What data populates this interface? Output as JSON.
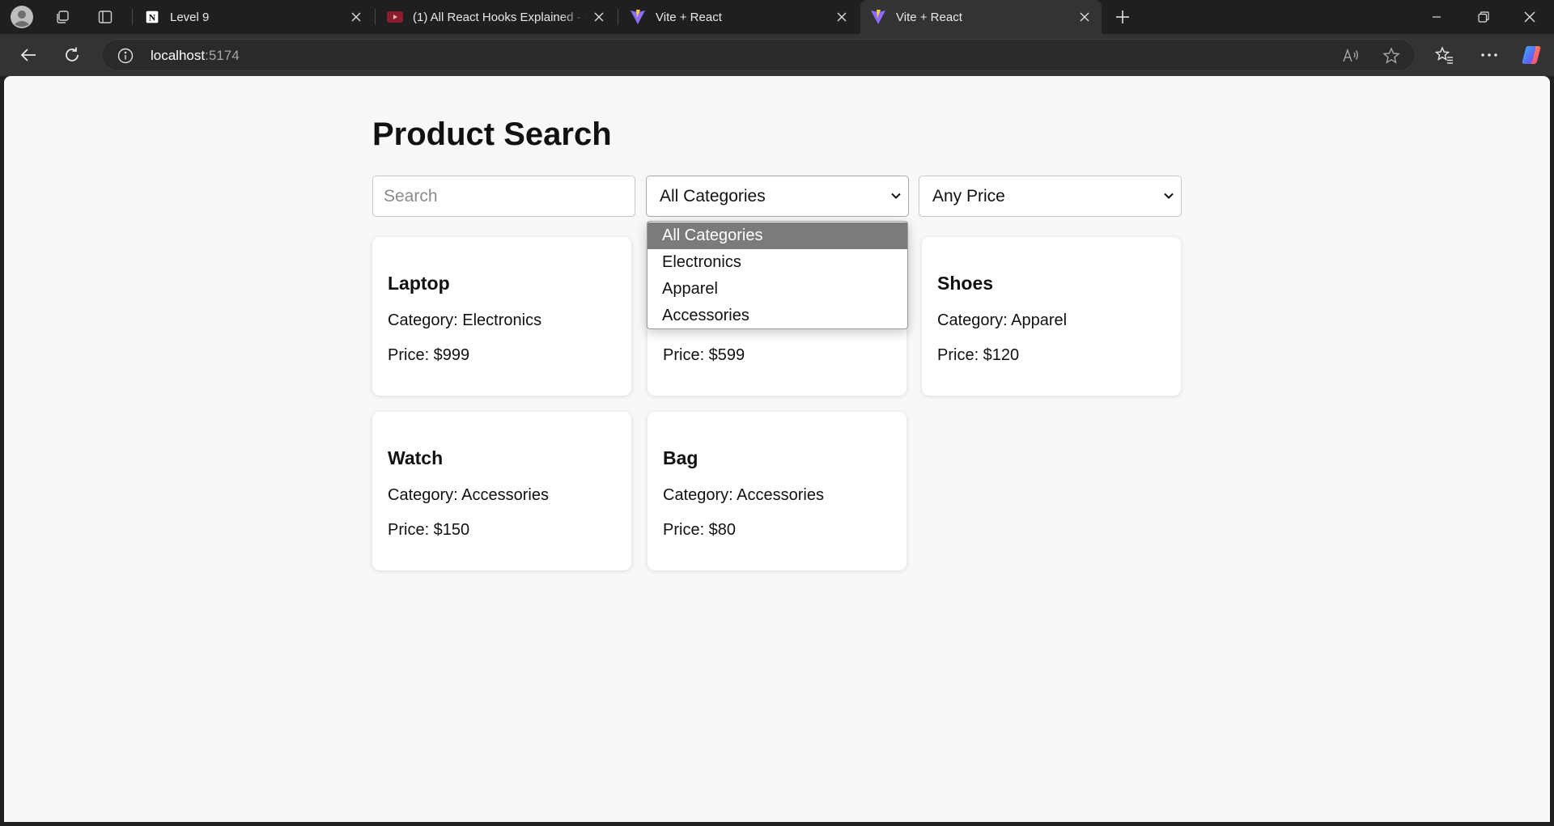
{
  "browser": {
    "tabs": [
      {
        "title": "Level 9",
        "favicon": "notion-icon",
        "active": false
      },
      {
        "title": "(1) All React Hooks Explained - Re",
        "favicon": "youtube-icon",
        "active": false
      },
      {
        "title": "Vite + React",
        "favicon": "vite-icon",
        "active": false
      },
      {
        "title": "Vite + React",
        "favicon": "vite-icon",
        "active": true
      }
    ],
    "address": {
      "host": "localhost",
      "port": ":5174"
    }
  },
  "page": {
    "title": "Product Search",
    "search_placeholder": "Search",
    "category_select": {
      "selected": "All Categories",
      "options": [
        "All Categories",
        "Electronics",
        "Apparel",
        "Accessories"
      ],
      "open": true
    },
    "price_select": {
      "selected": "Any Price"
    },
    "products": [
      {
        "name": "Laptop",
        "category_text": "Category: Electronics",
        "price_text": "Price: $999"
      },
      {
        "name": "",
        "category_text": "",
        "price_text": "Price: $599"
      },
      {
        "name": "Shoes",
        "category_text": "Category: Apparel",
        "price_text": "Price: $120"
      },
      {
        "name": "Watch",
        "category_text": "Category: Accessories",
        "price_text": "Price: $150"
      },
      {
        "name": "Bag",
        "category_text": "Category: Accessories",
        "price_text": "Price: $80"
      }
    ]
  },
  "colors": {
    "tabstrip_bg": "#1f1f1f",
    "toolbar_bg": "#333333",
    "page_bg": "#f8f8f8",
    "dropdown_selected_bg": "#7b7b7b"
  }
}
